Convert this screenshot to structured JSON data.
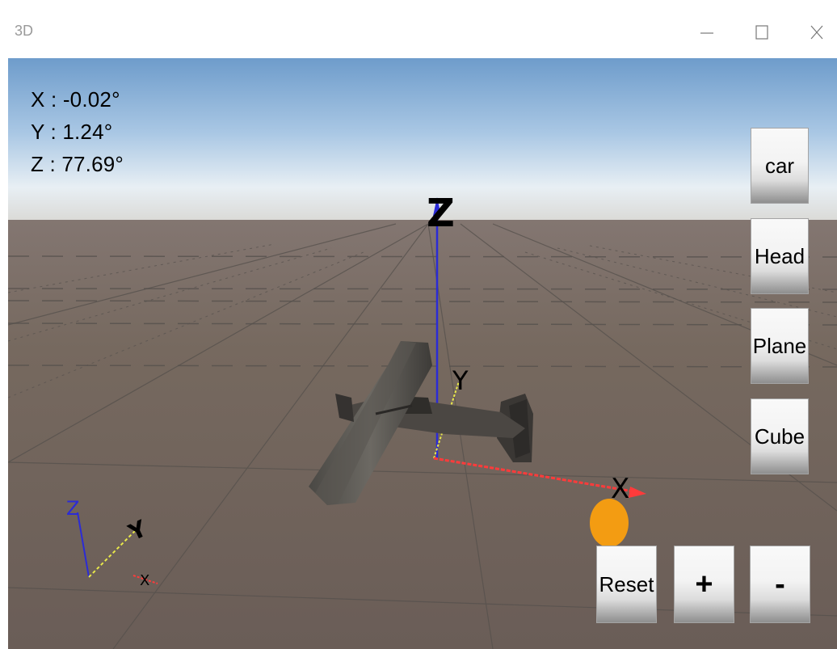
{
  "window": {
    "title": "3D",
    "controls": [
      "minimize-icon",
      "maximize-icon",
      "close-icon"
    ]
  },
  "readout": {
    "x": "X : -0.02°",
    "y": "Y : 1.24°",
    "z": "Z : 77.69°"
  },
  "axis_labels": {
    "main_z": "Z",
    "main_y": "Y",
    "main_x": "X",
    "mini_z": "Z",
    "mini_y": "Y",
    "mini_x": "X"
  },
  "model_buttons": [
    {
      "label": "car"
    },
    {
      "label": "Head"
    },
    {
      "label": "Plane"
    },
    {
      "label": "Cube"
    }
  ],
  "bottom_buttons": {
    "reset": "Reset",
    "plus": "+",
    "minus": "-"
  },
  "colors": {
    "x_axis": "#ff3b3b",
    "y_axis": "#e8e84a",
    "z_axis": "#2b2bd6",
    "handle": "#f39c12",
    "ground": "#6f625c",
    "sky_top": "#6f9fcf"
  }
}
